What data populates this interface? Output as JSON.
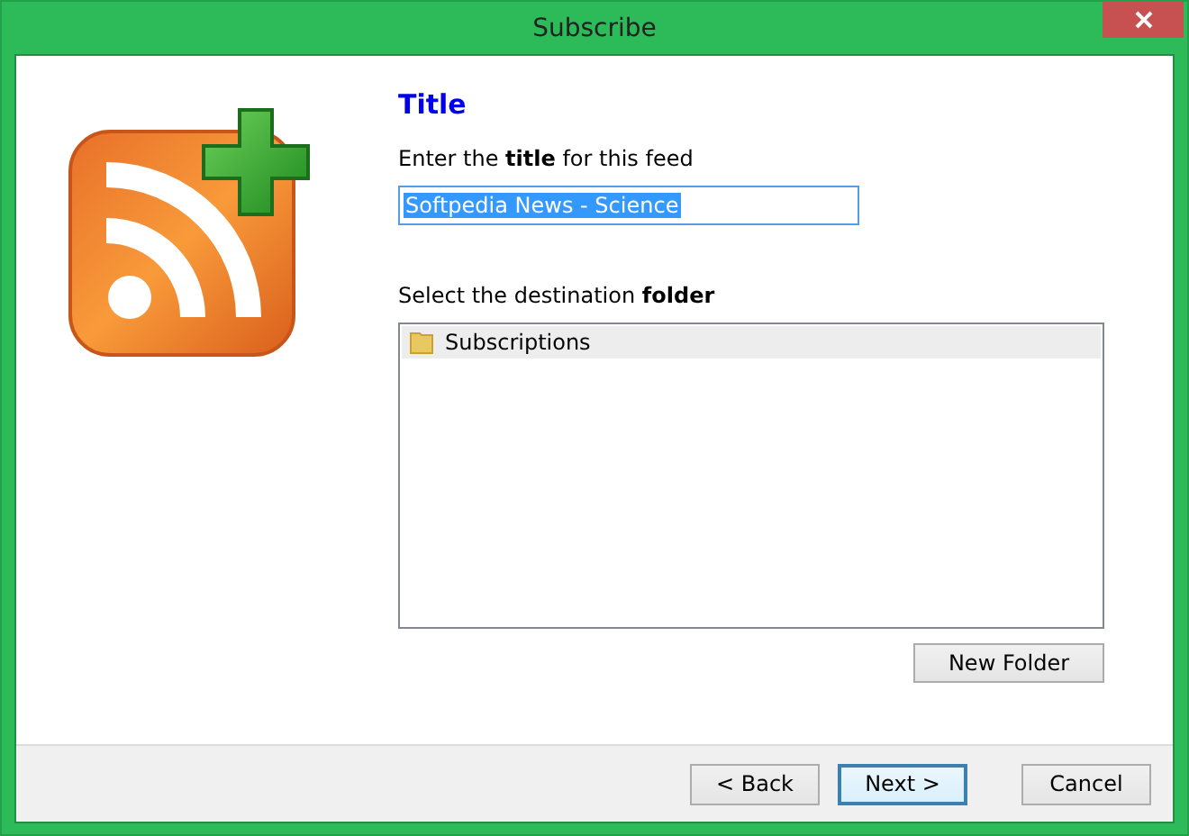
{
  "window": {
    "title": "Subscribe"
  },
  "heading": "Title",
  "title_field": {
    "label": "Enter the **title** for this feed",
    "value": "Softpedia News - Science",
    "text_selected": true
  },
  "folder_tree": {
    "label": "Select the destination **folder**",
    "items": [
      {
        "label": "Subscriptions",
        "selected": true
      }
    ]
  },
  "new_folder_button": "New Folder",
  "buttons": [
    {
      "label": "< Back",
      "focused": false
    },
    {
      "label": "Next >",
      "focused": true
    },
    {
      "label": "Cancel",
      "focused": false
    }
  ]
}
